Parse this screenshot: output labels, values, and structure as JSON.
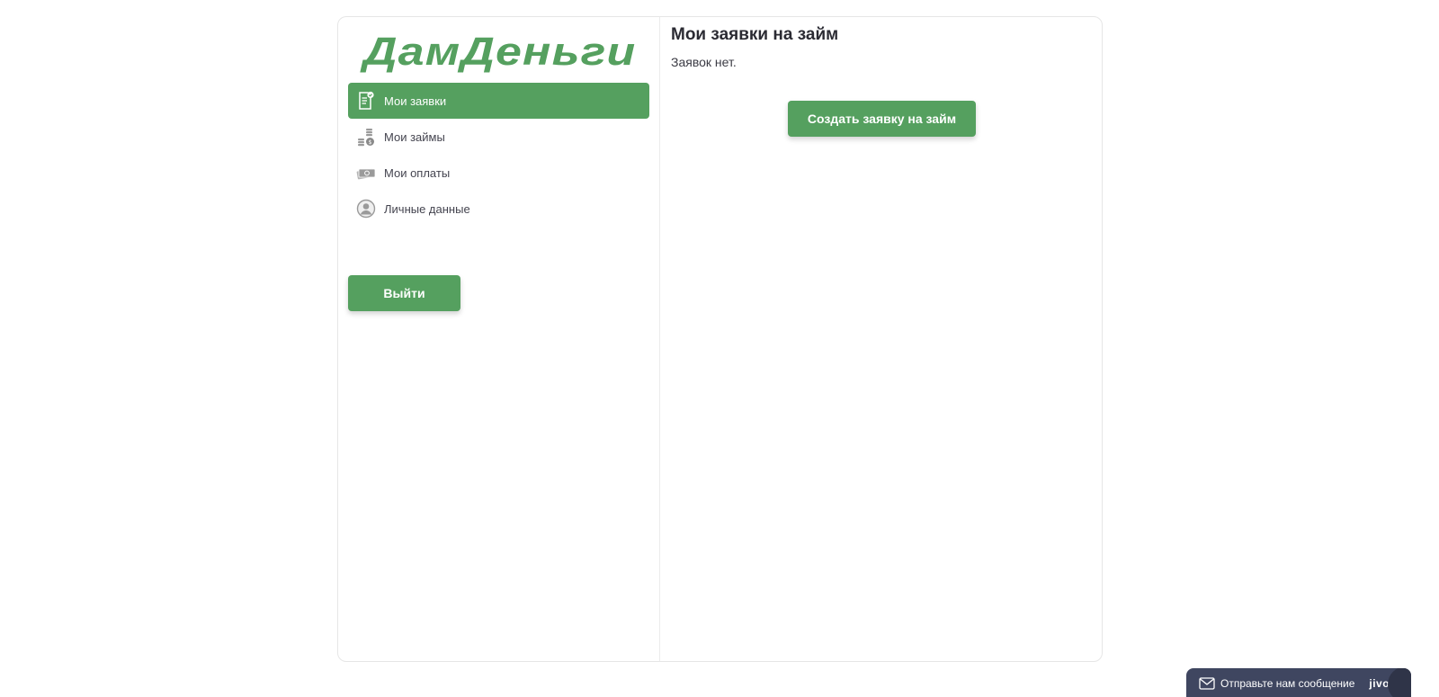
{
  "brand": {
    "logo_text": "ДамДеньги",
    "accent_color": "#55a05f"
  },
  "sidebar": {
    "items": [
      {
        "label": "Мои заявки",
        "icon": "application-document-icon",
        "active": true
      },
      {
        "label": "Мои займы",
        "icon": "coins-stack-icon",
        "active": false
      },
      {
        "label": "Мои оплаты",
        "icon": "banknotes-icon",
        "active": false
      },
      {
        "label": "Личные данные",
        "icon": "user-avatar-icon",
        "active": false
      }
    ],
    "logout_label": "Выйти"
  },
  "main": {
    "title": "Мои заявки на займ",
    "empty_text": "Заявок нет.",
    "create_button_label": "Создать заявку на займ"
  },
  "chat_widget": {
    "label": "Отправьте нам сообщение",
    "brand": "jivo",
    "icon": "mail-icon",
    "background_color": "#3f4660"
  }
}
